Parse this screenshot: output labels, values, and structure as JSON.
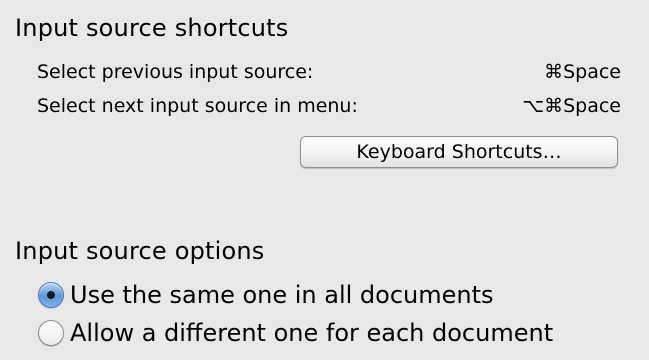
{
  "shortcuts_section": {
    "title": "Input source shortcuts",
    "rows": [
      {
        "label": "Select previous input source:",
        "shortcut": "⌘Space"
      },
      {
        "label": "Select next input source in menu:",
        "shortcut": "⌥⌘Space"
      }
    ],
    "button_label": "Keyboard Shortcuts…"
  },
  "options_section": {
    "title": "Input source options",
    "options": [
      {
        "label": "Use the same one in all documents",
        "selected": true
      },
      {
        "label": "Allow a different one for each document",
        "selected": false
      }
    ]
  }
}
